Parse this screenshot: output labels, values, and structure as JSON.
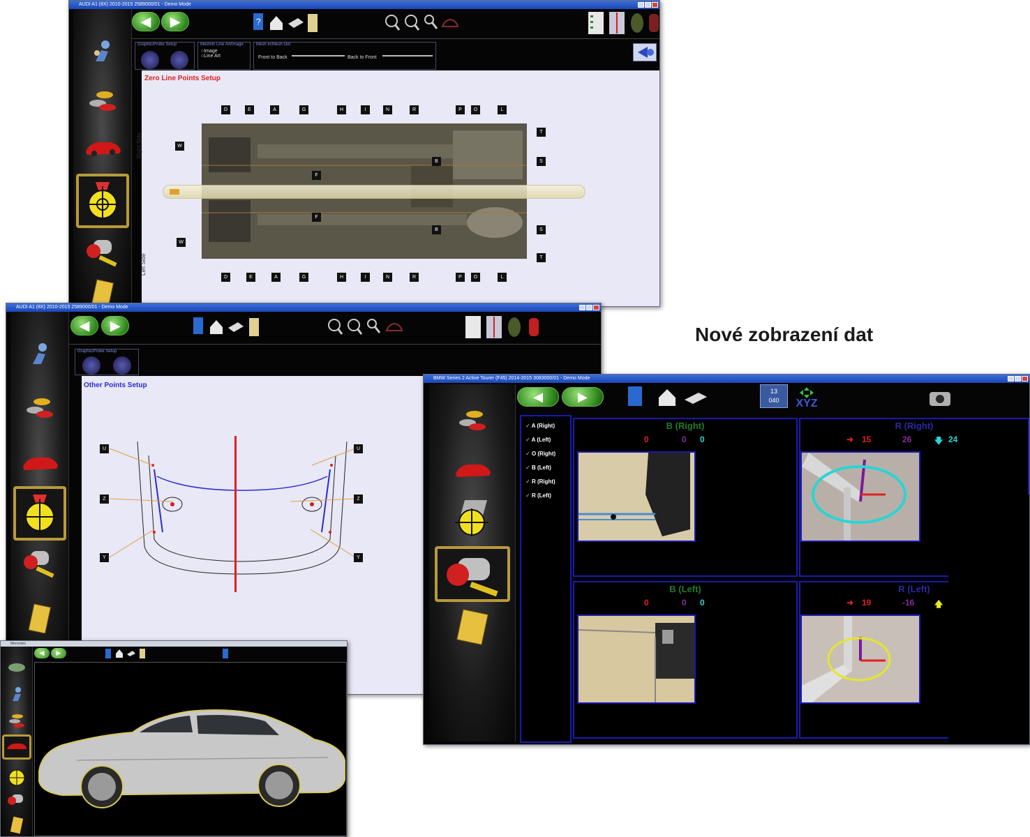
{
  "caption": "Nové zobrazení dat",
  "win1": {
    "title": "AUDI A1 (8X) 2010-2015 2589000/01 - Demo Mode",
    "panel1_title": "Graphic/Probe Setup",
    "panel2_title": "Mesh/In Line Art/Image",
    "radio_image": "Image",
    "radio_lineart": "Line Art",
    "panel3_title": "Mesh In/Mesh Out",
    "front_to_back": "Front to Back",
    "back_to_front": "Back to Front",
    "heading": "Zero Line Points Setup",
    "right_side": "Right Side",
    "left_side": "Left Side",
    "top_labels": [
      "D",
      "E",
      "A",
      "G",
      "H",
      "I",
      "N",
      "R",
      "P",
      "O",
      "L"
    ],
    "bottom_labels": [
      "D",
      "E",
      "A",
      "G",
      "H",
      "I",
      "N",
      "R",
      "P",
      "O",
      "L"
    ],
    "side_labels": {
      "w1": "W",
      "w2": "W",
      "t1": "T",
      "s1": "S",
      "s2": "S",
      "t2": "T",
      "f1": "F",
      "f2": "F",
      "b1": "B",
      "b2": "B"
    }
  },
  "win2": {
    "title": "AUDI A1 (8X) 2010-2015 2589000/01 - Demo Mode",
    "panel1_title": "Graphic/Probe Setup",
    "heading": "Other Points Setup",
    "labels_left": [
      "U",
      "Z",
      "Y"
    ],
    "labels_right": [
      "U",
      "Z",
      "Y"
    ]
  },
  "win3": {
    "title": "BMW Series 2 Active Tourer (F45) 2014-2015 3083000/01 - Demo Mode",
    "xyz": "XYZ",
    "counter_top": "13",
    "counter_bottom": "040",
    "list": [
      "A (Right)",
      "A (Left)",
      "O (Right)",
      "B (Left)",
      "R (Right)",
      "R (Left)"
    ],
    "tiles": [
      {
        "name": "B (Right)",
        "name_color": "#1f7a2a",
        "v1": "0",
        "v2": "0",
        "v3": "0",
        "arrow": ""
      },
      {
        "name": "R (Right)",
        "name_color": "#2a2aa8",
        "v1": "15",
        "v2": "26",
        "v3": "24",
        "arrow": "down"
      },
      {
        "name": "B (Left)",
        "name_color": "#1f7a2a",
        "v1": "0",
        "v2": "0",
        "v3": "0",
        "arrow": ""
      },
      {
        "name": "R (Left)",
        "name_color": "#2a2aa8",
        "v1": "19",
        "v2": "-16",
        "v3": "",
        "arrow": "up"
      }
    ]
  },
  "win4": {
    "title": "Mercedes"
  },
  "colors": {
    "red": "#e02020",
    "purple": "#8a2aa0",
    "cyan": "#2ad4d4",
    "yellow": "#e6e62a",
    "green_title": "#1f7a2a",
    "blue_title": "#2a2aa8"
  }
}
